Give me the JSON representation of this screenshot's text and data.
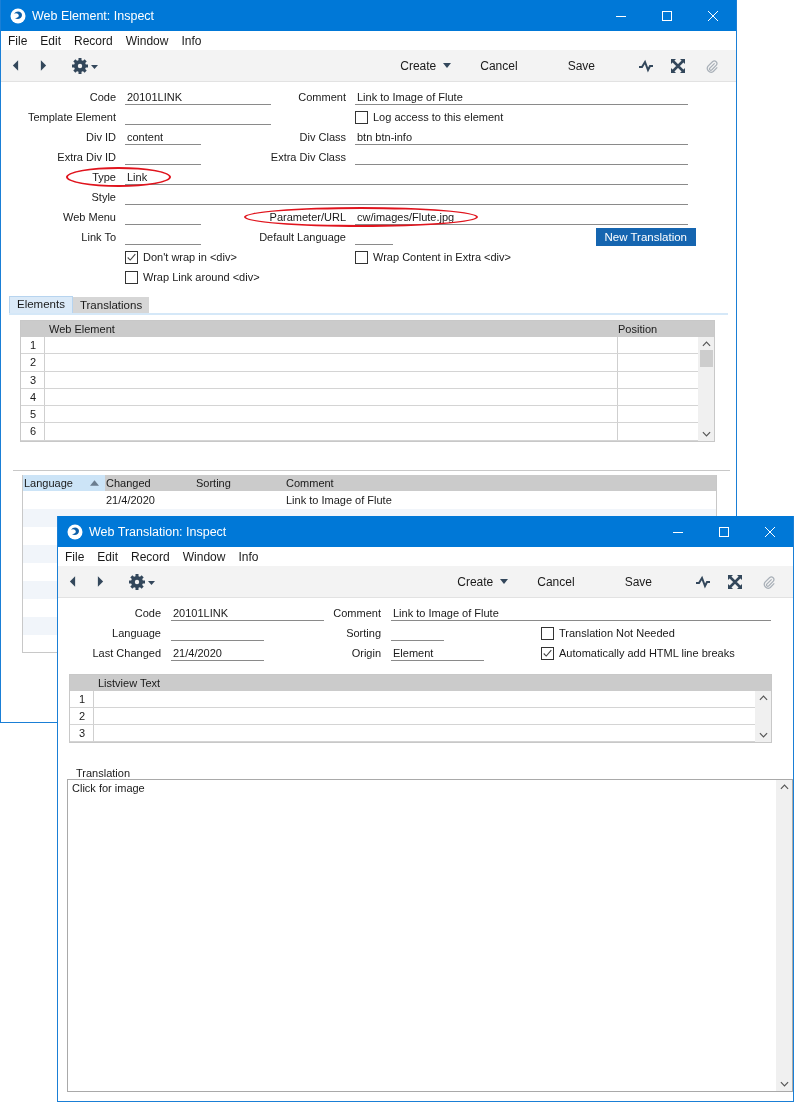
{
  "element_window": {
    "title": "Web Element: Inspect",
    "menu": [
      "File",
      "Edit",
      "Record",
      "Window",
      "Info"
    ],
    "toolbar": [
      {
        "label": "Create",
        "dropdown": true
      },
      {
        "label": "Cancel",
        "dropdown": false
      },
      {
        "label": "Save",
        "dropdown": false
      }
    ],
    "form": [
      [
        {
          "kind": "field",
          "label": "Code",
          "value": "20101LINK",
          "circled": false
        },
        {
          "kind": "field",
          "label": "Comment",
          "value": "Link to Image of Flute",
          "circled": false
        }
      ],
      [
        {
          "kind": "field",
          "label": "Template Element",
          "circled": false
        },
        {
          "kind": "checkbox",
          "label": "Log access to this element",
          "checked": false
        }
      ],
      [
        {
          "kind": "field",
          "label": "Div ID",
          "value": "content",
          "circled": false
        },
        {
          "kind": "field",
          "label": "Div Class",
          "value": "btn btn-info",
          "circled": false
        }
      ],
      [
        {
          "kind": "field",
          "label": "Extra Div ID",
          "circled": false
        },
        {
          "kind": "field",
          "label": "Extra Div Class",
          "circled": false
        }
      ],
      [
        {
          "kind": "field",
          "label": "Type",
          "value": "Link",
          "circled": true
        }
      ],
      [
        {
          "kind": "field",
          "label": "Style",
          "circled": false
        }
      ],
      [
        {
          "kind": "field",
          "label": "Web Menu",
          "circled": false
        },
        {
          "kind": "field",
          "label": "Parameter/URL",
          "value": "cw/images/Flute.jpg",
          "circled": true
        }
      ],
      [
        {
          "kind": "field",
          "label": "Link To",
          "circled": false
        },
        {
          "kind": "field",
          "label": "Default Language",
          "circled": false
        },
        {
          "kind": "button",
          "label": "New Translation"
        }
      ],
      [
        {
          "kind": "checkbox",
          "label": "Don't wrap in <div>",
          "checked": true
        },
        {
          "kind": "checkbox",
          "label": "Wrap Content in Extra <div>",
          "checked": false
        }
      ],
      [
        {
          "kind": "checkbox",
          "label": "Wrap Link around <div>",
          "checked": false
        }
      ]
    ],
    "tabs": [
      {
        "label": "Elements",
        "selected": true
      },
      {
        "label": "Translations",
        "selected": false
      }
    ],
    "elements_table": {
      "columns": [
        "Web Element",
        "Position"
      ],
      "row_numbers": [
        "1",
        "2",
        "3",
        "4",
        "5",
        "6"
      ]
    },
    "translations_list": {
      "columns": [
        {
          "label": "Language",
          "sorted": true
        },
        {
          "label": "Changed",
          "sorted": false
        },
        {
          "label": "Sorting",
          "sorted": false
        },
        {
          "label": "Comment",
          "sorted": false
        }
      ],
      "rows": [
        [
          null,
          "21/4/2020",
          null,
          "Link to Image of Flute"
        ]
      ]
    }
  },
  "translation_window": {
    "title": "Web Translation: Inspect",
    "menu": [
      "File",
      "Edit",
      "Record",
      "Window",
      "Info"
    ],
    "toolbar": [
      {
        "label": "Create",
        "dropdown": true
      },
      {
        "label": "Cancel",
        "dropdown": false
      },
      {
        "label": "Save",
        "dropdown": false
      }
    ],
    "form": [
      [
        {
          "kind": "field",
          "label": "Code",
          "value": "20101LINK",
          "circled": false
        },
        {
          "kind": "field",
          "label": "Comment",
          "value": "Link to Image of Flute",
          "circled": false
        }
      ],
      [
        {
          "kind": "field",
          "label": "Language",
          "circled": false
        },
        {
          "kind": "field",
          "label": "Sorting",
          "circled": false
        },
        {
          "kind": "checkbox",
          "label": "Translation Not Needed",
          "checked": false
        }
      ],
      [
        {
          "kind": "field",
          "label": "Last Changed",
          "value": "21/4/2020",
          "circled": false
        },
        {
          "kind": "field",
          "label": "Origin",
          "value": "Element",
          "circled": false
        },
        {
          "kind": "checkbox",
          "label": "Automatically add HTML line breaks",
          "checked": true
        }
      ]
    ],
    "listview": {
      "columns": [
        "Listview Text"
      ],
      "row_numbers": [
        "1",
        "2",
        "3"
      ]
    },
    "translation": {
      "label": "Translation",
      "value": "Click for image"
    }
  }
}
